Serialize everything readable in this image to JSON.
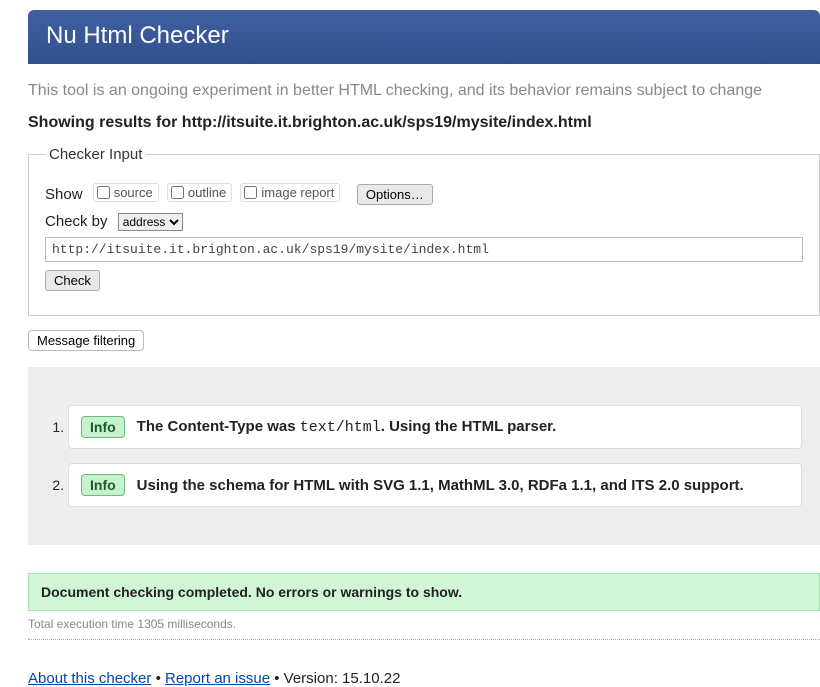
{
  "header": {
    "title": "Nu Html Checker"
  },
  "intro": "This tool is an ongoing experiment in better HTML checking, and its behavior remains subject to change",
  "results_label_prefix": "Showing results for ",
  "results_url": "http://itsuite.it.brighton.ac.uk/sps19/mysite/index.html",
  "form": {
    "legend": "Checker Input",
    "show_label": "Show",
    "cb_source": "source",
    "cb_outline": "outline",
    "cb_image_report": "image report",
    "options_btn": "Options…",
    "check_by_label": "Check by",
    "check_by_selected": "address",
    "address_value": "http://itsuite.it.brighton.ac.uk/sps19/mysite/index.html",
    "check_btn": "Check"
  },
  "msg_filter_btn": "Message filtering",
  "messages": [
    {
      "badge": "Info",
      "html": "The Content-Type was <code>text/html</code>. Using the HTML parser."
    },
    {
      "badge": "Info",
      "html": "Using the schema for HTML with SVG 1.1, MathML 3.0, RDFa 1.1, and ITS 2.0 support."
    }
  ],
  "success": "Document checking completed. No errors or warnings to show.",
  "exec_time": "Total execution time 1305 milliseconds.",
  "footer": {
    "about": "About this checker",
    "report": "Report an issue",
    "version_label": "Version: ",
    "version": "15.10.22"
  }
}
